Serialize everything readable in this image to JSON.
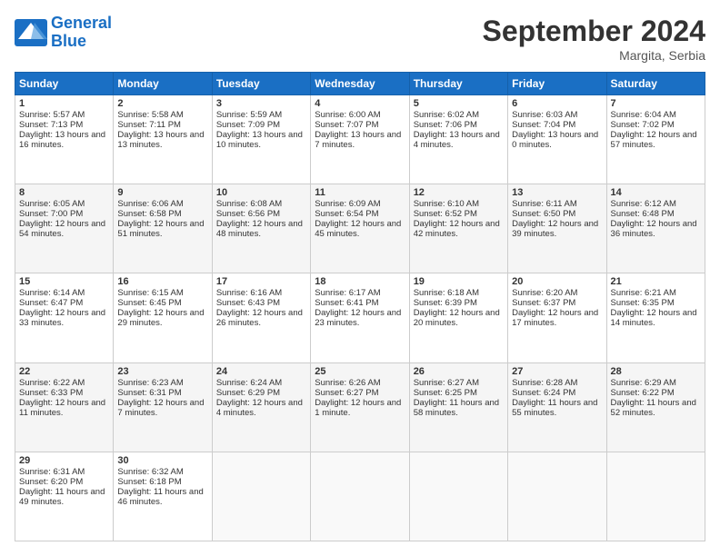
{
  "logo": {
    "line1": "General",
    "line2": "Blue"
  },
  "title": "September 2024",
  "location": "Margita, Serbia",
  "days_header": [
    "Sunday",
    "Monday",
    "Tuesday",
    "Wednesday",
    "Thursday",
    "Friday",
    "Saturday"
  ],
  "weeks": [
    [
      {
        "day": "1",
        "sunrise": "5:57 AM",
        "sunset": "7:13 PM",
        "daylight": "13 hours and 16 minutes."
      },
      {
        "day": "2",
        "sunrise": "5:58 AM",
        "sunset": "7:11 PM",
        "daylight": "13 hours and 13 minutes."
      },
      {
        "day": "3",
        "sunrise": "5:59 AM",
        "sunset": "7:09 PM",
        "daylight": "13 hours and 10 minutes."
      },
      {
        "day": "4",
        "sunrise": "6:00 AM",
        "sunset": "7:07 PM",
        "daylight": "13 hours and 7 minutes."
      },
      {
        "day": "5",
        "sunrise": "6:02 AM",
        "sunset": "7:06 PM",
        "daylight": "13 hours and 4 minutes."
      },
      {
        "day": "6",
        "sunrise": "6:03 AM",
        "sunset": "7:04 PM",
        "daylight": "13 hours and 0 minutes."
      },
      {
        "day": "7",
        "sunrise": "6:04 AM",
        "sunset": "7:02 PM",
        "daylight": "12 hours and 57 minutes."
      }
    ],
    [
      {
        "day": "8",
        "sunrise": "6:05 AM",
        "sunset": "7:00 PM",
        "daylight": "12 hours and 54 minutes."
      },
      {
        "day": "9",
        "sunrise": "6:06 AM",
        "sunset": "6:58 PM",
        "daylight": "12 hours and 51 minutes."
      },
      {
        "day": "10",
        "sunrise": "6:08 AM",
        "sunset": "6:56 PM",
        "daylight": "12 hours and 48 minutes."
      },
      {
        "day": "11",
        "sunrise": "6:09 AM",
        "sunset": "6:54 PM",
        "daylight": "12 hours and 45 minutes."
      },
      {
        "day": "12",
        "sunrise": "6:10 AM",
        "sunset": "6:52 PM",
        "daylight": "12 hours and 42 minutes."
      },
      {
        "day": "13",
        "sunrise": "6:11 AM",
        "sunset": "6:50 PM",
        "daylight": "12 hours and 39 minutes."
      },
      {
        "day": "14",
        "sunrise": "6:12 AM",
        "sunset": "6:48 PM",
        "daylight": "12 hours and 36 minutes."
      }
    ],
    [
      {
        "day": "15",
        "sunrise": "6:14 AM",
        "sunset": "6:47 PM",
        "daylight": "12 hours and 33 minutes."
      },
      {
        "day": "16",
        "sunrise": "6:15 AM",
        "sunset": "6:45 PM",
        "daylight": "12 hours and 29 minutes."
      },
      {
        "day": "17",
        "sunrise": "6:16 AM",
        "sunset": "6:43 PM",
        "daylight": "12 hours and 26 minutes."
      },
      {
        "day": "18",
        "sunrise": "6:17 AM",
        "sunset": "6:41 PM",
        "daylight": "12 hours and 23 minutes."
      },
      {
        "day": "19",
        "sunrise": "6:18 AM",
        "sunset": "6:39 PM",
        "daylight": "12 hours and 20 minutes."
      },
      {
        "day": "20",
        "sunrise": "6:20 AM",
        "sunset": "6:37 PM",
        "daylight": "12 hours and 17 minutes."
      },
      {
        "day": "21",
        "sunrise": "6:21 AM",
        "sunset": "6:35 PM",
        "daylight": "12 hours and 14 minutes."
      }
    ],
    [
      {
        "day": "22",
        "sunrise": "6:22 AM",
        "sunset": "6:33 PM",
        "daylight": "12 hours and 11 minutes."
      },
      {
        "day": "23",
        "sunrise": "6:23 AM",
        "sunset": "6:31 PM",
        "daylight": "12 hours and 7 minutes."
      },
      {
        "day": "24",
        "sunrise": "6:24 AM",
        "sunset": "6:29 PM",
        "daylight": "12 hours and 4 minutes."
      },
      {
        "day": "25",
        "sunrise": "6:26 AM",
        "sunset": "6:27 PM",
        "daylight": "12 hours and 1 minute."
      },
      {
        "day": "26",
        "sunrise": "6:27 AM",
        "sunset": "6:25 PM",
        "daylight": "11 hours and 58 minutes."
      },
      {
        "day": "27",
        "sunrise": "6:28 AM",
        "sunset": "6:24 PM",
        "daylight": "11 hours and 55 minutes."
      },
      {
        "day": "28",
        "sunrise": "6:29 AM",
        "sunset": "6:22 PM",
        "daylight": "11 hours and 52 minutes."
      }
    ],
    [
      {
        "day": "29",
        "sunrise": "6:31 AM",
        "sunset": "6:20 PM",
        "daylight": "11 hours and 49 minutes."
      },
      {
        "day": "30",
        "sunrise": "6:32 AM",
        "sunset": "6:18 PM",
        "daylight": "11 hours and 46 minutes."
      },
      null,
      null,
      null,
      null,
      null
    ]
  ]
}
